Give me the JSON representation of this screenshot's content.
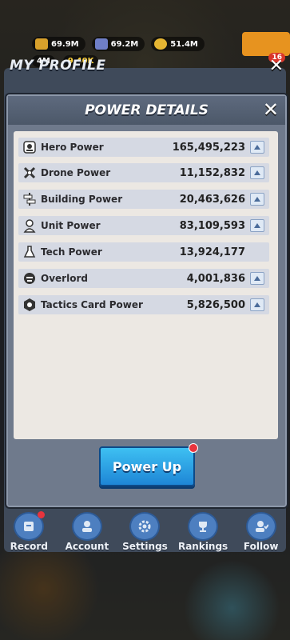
{
  "resources": {
    "top": [
      "69.9M",
      "69.2M",
      "51.4M"
    ],
    "second": [
      "4M",
      "9.40K"
    ],
    "badge": "16"
  },
  "profile": {
    "title": "MY PROFILE",
    "close": "✕"
  },
  "modal": {
    "title": "POWER DETAILS",
    "close": "✕",
    "rows": [
      {
        "label": "Hero Power",
        "value": "165,495,223",
        "icon": "hero-icon",
        "has_up": true
      },
      {
        "label": "Drone Power",
        "value": "11,152,832",
        "icon": "drone-icon",
        "has_up": true
      },
      {
        "label": "Building Power",
        "value": "20,463,626",
        "icon": "building-icon",
        "has_up": true
      },
      {
        "label": "Unit Power",
        "value": "83,109,593",
        "icon": "unit-icon",
        "has_up": true
      },
      {
        "label": "Tech Power",
        "value": "13,924,177",
        "icon": "tech-flask-icon",
        "has_up": false
      },
      {
        "label": "Overlord",
        "value": "4,001,836",
        "icon": "overlord-icon",
        "has_up": true
      },
      {
        "label": "Tactics Card Power",
        "value": "5,826,500",
        "icon": "tactics-card-icon",
        "has_up": true
      }
    ],
    "power_up_label": "Power Up"
  },
  "nav": [
    {
      "label": "Record",
      "icon": "record-icon",
      "dot": true
    },
    {
      "label": "Account",
      "icon": "account-icon",
      "dot": false
    },
    {
      "label": "Settings",
      "icon": "settings-gear-icon",
      "dot": false
    },
    {
      "label": "Rankings",
      "icon": "trophy-icon",
      "dot": false
    },
    {
      "label": "Follow",
      "icon": "follow-icon",
      "dot": false
    }
  ],
  "colors": {
    "accent": "#1e86d6",
    "row_bg": "#d5d9e3",
    "panel_bg": "#ece8e3"
  }
}
